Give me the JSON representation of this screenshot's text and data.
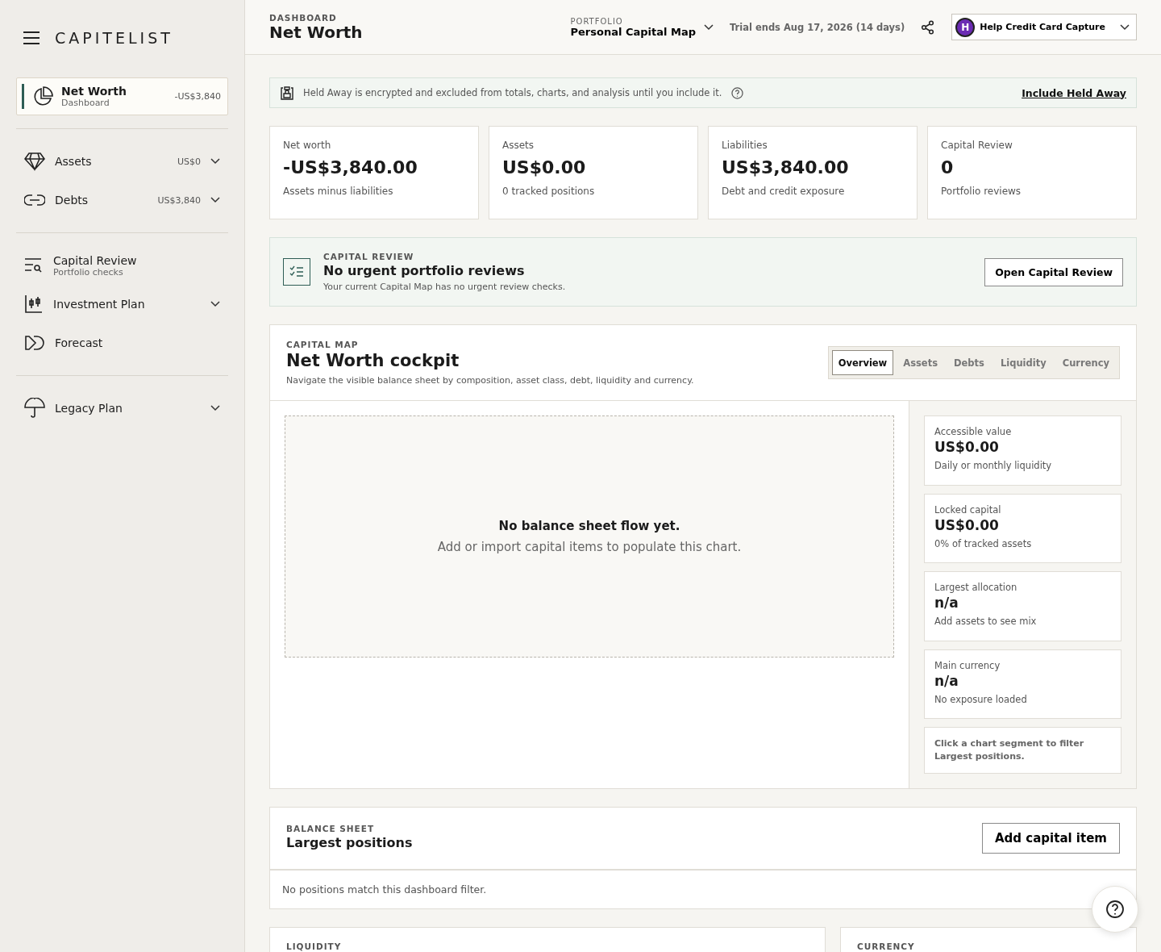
{
  "brand": {
    "name": "CAPITELIST"
  },
  "sidebar": {
    "active": {
      "title": "Net Worth",
      "subtitle": "Dashboard",
      "amount": "-US$3,840",
      "selected": true
    },
    "groups": [
      {
        "items": [
          {
            "kind": "diamond",
            "label": "Assets",
            "amount": "US$0",
            "expandable": true
          },
          {
            "kind": "link",
            "label": "Debts",
            "amount": "US$3,840",
            "expandable": true
          }
        ]
      },
      {
        "items": [
          {
            "kind": "review",
            "label": "Capital Review",
            "subtitle": "Portfolio checks",
            "expandable": false
          },
          {
            "kind": "candles",
            "label": "Investment Plan",
            "expandable": true
          },
          {
            "kind": "forward",
            "label": "Forecast",
            "expandable": false
          }
        ]
      },
      {
        "items": [
          {
            "kind": "umbrella",
            "label": "Legacy Plan",
            "expandable": true
          }
        ]
      }
    ]
  },
  "header": {
    "eyebrow": "DASHBOARD",
    "title": "Net Worth",
    "portfolio_label": "PORTFOLIO",
    "portfolio": "Personal Capital Map",
    "trial": "Trial ends Aug 17, 2026 (14 days)",
    "account": {
      "initial": "H",
      "name": "Help Credit Card Capture"
    }
  },
  "notice": {
    "text": "Held Away is encrypted and excluded from totals, charts, and analysis until you include it.",
    "link": "Include Held Away"
  },
  "stats": [
    {
      "label": "Net worth",
      "value": "-US$3,840.00",
      "note": "Assets minus liabilities"
    },
    {
      "label": "Assets",
      "value": "US$0.00",
      "note": "0 tracked positions"
    },
    {
      "label": "Liabilities",
      "value": "US$3,840.00",
      "note": "Debt and credit exposure"
    },
    {
      "label": "Capital Review",
      "value": "0",
      "note": "Portfolio reviews"
    }
  ],
  "review_banner": {
    "eyebrow": "CAPITAL REVIEW",
    "title": "No urgent portfolio reviews",
    "text": "Your current Capital Map has no urgent review checks.",
    "button": "Open Capital Review"
  },
  "capital_map": {
    "eyebrow": "CAPITAL MAP",
    "title": "Net Worth cockpit",
    "description": "Navigate the visible balance sheet by composition, asset class, debt, liquidity and currency.",
    "tabs": [
      {
        "label": "Overview",
        "selected": true
      },
      {
        "label": "Assets",
        "selected": false
      },
      {
        "label": "Debts",
        "selected": false
      },
      {
        "label": "Liquidity",
        "selected": false
      },
      {
        "label": "Currency",
        "selected": false
      }
    ],
    "empty_title": "No balance sheet flow yet.",
    "empty_text": "Add or import capital items to populate this chart.",
    "metrics": [
      {
        "label": "Accessible value",
        "value": "US$0.00",
        "note": "Daily or monthly liquidity"
      },
      {
        "label": "Locked capital",
        "value": "US$0.00",
        "note": "0% of tracked assets"
      },
      {
        "label": "Largest allocation",
        "value": "n/a",
        "note": "Add assets to see mix"
      },
      {
        "label": "Main currency",
        "value": "n/a",
        "note": "No exposure loaded"
      }
    ],
    "hint": "Click a chart segment to filter Largest positions."
  },
  "balance_sheet": {
    "eyebrow": "BALANCE SHEET",
    "title": "Largest positions",
    "button": "Add capital item",
    "empty": "No positions match this dashboard filter."
  },
  "lower_cards": [
    {
      "eyebrow": "LIQUIDITY"
    },
    {
      "eyebrow": "CURRENCY"
    }
  ]
}
